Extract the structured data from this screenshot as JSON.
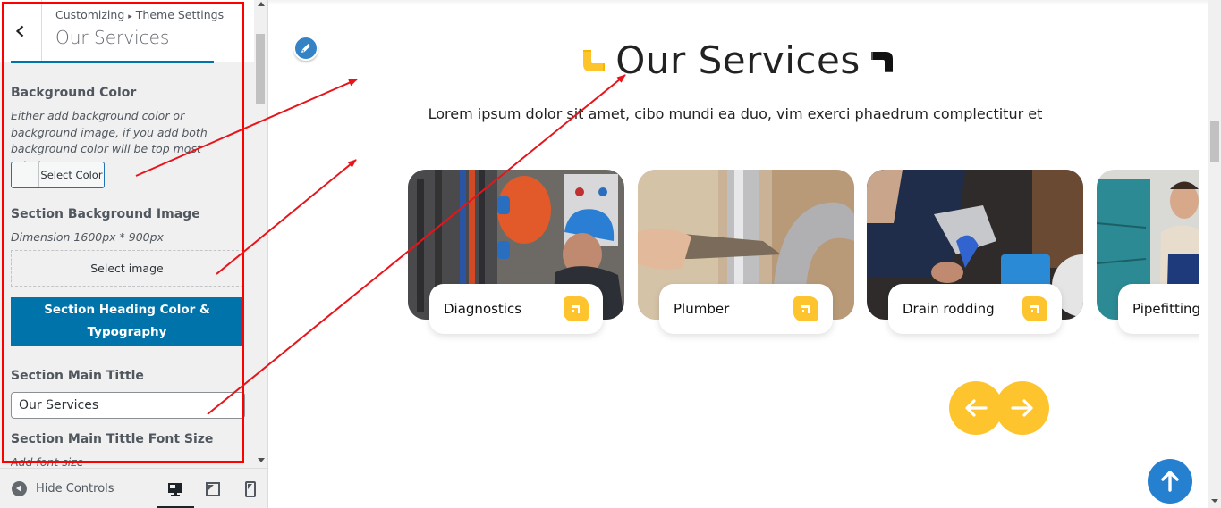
{
  "sidebar": {
    "breadcrumb_root": "Customizing",
    "breadcrumb_sep": "▸",
    "breadcrumb_section": "Theme Settings",
    "title": "Our Services",
    "controls": {
      "bg_color_label": "Background Color",
      "bg_color_desc": "Either add background color or background image, if you add both background color will be top most priority",
      "select_color_button": "Select Color",
      "bg_image_label": "Section Background Image",
      "bg_image_desc": "Dimension 1600px * 900px",
      "select_image_button": "Select image",
      "heading_typography_button_line1": "Section Heading Color &",
      "heading_typography_button_line2": "Typography",
      "main_title_label": "Section Main Tittle",
      "main_title_value": "Our Services",
      "main_title_font_size_label": "Section Main Tittle Font Size",
      "main_title_font_size_desc": "Add font size"
    },
    "footer": {
      "hide_controls": "Hide Controls",
      "devices": [
        "desktop",
        "tablet",
        "mobile"
      ],
      "active_device": "desktop"
    }
  },
  "preview": {
    "section_title": "Our Services",
    "section_description": "Lorem ipsum dolor sit amet, cibo mundi ea duo, vim exerci phaedrum complectitur et",
    "accent_color": "#fec42d",
    "services": [
      {
        "name": "Diagnostics",
        "icon": "faucet-icon"
      },
      {
        "name": "Plumber",
        "icon": "faucet-icon"
      },
      {
        "name": "Drain rodding",
        "icon": "faucet-icon"
      },
      {
        "name": "Pipefitting",
        "icon": "faucet-icon"
      }
    ],
    "nav": {
      "prev": "arrow-left-icon",
      "next": "arrow-right-icon"
    },
    "scroll_top": "arrow-up-icon"
  }
}
